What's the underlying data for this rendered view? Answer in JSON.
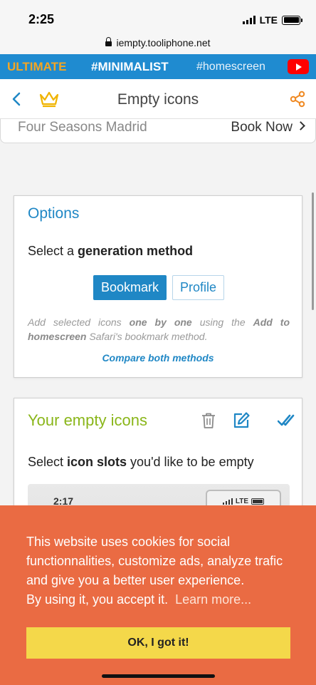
{
  "status_bar": {
    "time": "2:25",
    "network": "LTE",
    "battery_level": 1.0
  },
  "browser": {
    "url": "iempty.tooliphone.net"
  },
  "banner": {
    "ultimate": "ULTIMATE",
    "minimalist": "#MINIMALIST",
    "homescreen": "#homescreen",
    "video_icon": "youtube-icon"
  },
  "nav": {
    "title": "Empty icons",
    "left_icons": [
      "chevron-left-icon",
      "crown-icon"
    ],
    "right_icon": "share-icon"
  },
  "ad": {
    "text": "Four Seasons Madrid",
    "cta": "Book Now"
  },
  "options": {
    "title": "Options",
    "prompt_prefix": "Select a ",
    "prompt_bold": "generation method",
    "bookmark_label": "Bookmark",
    "profile_label": "Profile",
    "desc_1": "Add selected icons ",
    "desc_bold_1": "one by one",
    "desc_2": " using the ",
    "desc_bold_2": "Add to homescreen",
    "desc_3": " Safari's bookmark method.",
    "compare_link": "Compare both methods"
  },
  "empty_icons": {
    "title": "Your empty icons",
    "prompt_prefix": "Select ",
    "prompt_bold": "icon slots",
    "prompt_suffix": " you'd like to be empty",
    "preview_time": "2:17",
    "preview_network": "LTE"
  },
  "cookie": {
    "message": "This website uses cookies for social functionnalities, customize ads, analyze trafic and give you a better user experience.",
    "accept_note": "By using it, you accept it.",
    "learn_more": "Learn more...",
    "ok_label": "OK, I got it!"
  },
  "colors": {
    "banner_blue": "#1f8bd0",
    "accent_blue": "#1f87c5",
    "ultimate_orange": "#f5a623",
    "title_green": "#8ab61a",
    "cookie_orange": "#ea6b43",
    "ok_yellow": "#f4d84a"
  }
}
